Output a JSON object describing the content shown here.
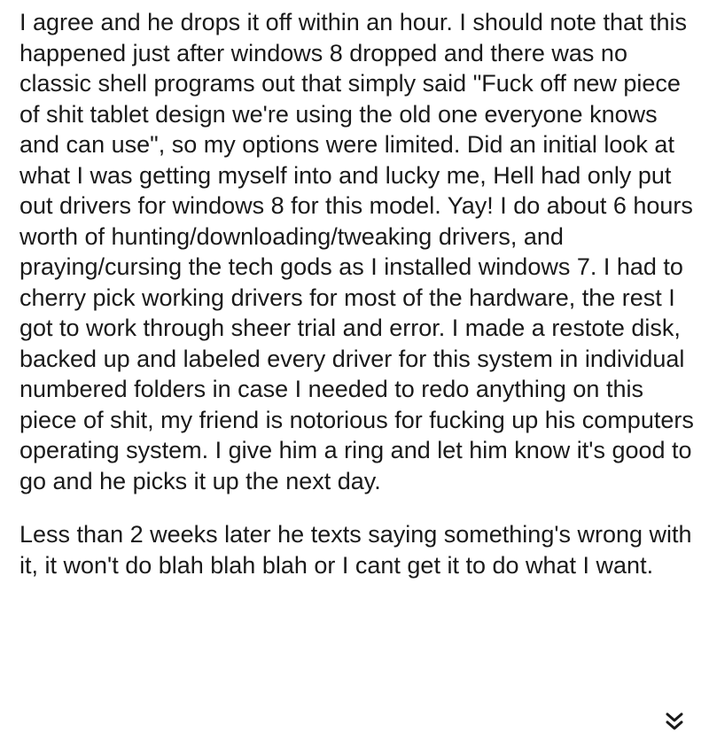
{
  "post": {
    "paragraphs": [
      "I agree and he drops it off within an hour. I should note that this happened just after windows 8 dropped and there was no classic shell programs out that simply said \"Fuck off new piece of shit tablet design we're using the old one everyone knows and can use\", so my options were limited. Did an initial look at what I was getting myself into and lucky me, Hell had only put out drivers for windows 8 for this model. Yay! I do about 6 hours worth of hunting/downloading/tweaking drivers, and praying/cursing the tech gods as I installed windows 7. I had to cherry pick working drivers for most of the hardware, the rest I got to work through sheer trial and error. I made a restote disk, backed up and labeled every driver for this system in individual numbered folders in case I needed to redo anything on this piece of shit, my friend is notorious for fucking up his computers operating system. I give him a ring and let him know it's good to go and he picks it up the next day.",
      "Less than 2 weeks later he texts saying something's wrong with it, it won't do blah blah blah or I cant get it to do what I want."
    ]
  },
  "controls": {
    "expand_icon": "double-chevron-down-icon"
  },
  "colors": {
    "text": "#1a1a1a",
    "background": "#ffffff"
  }
}
